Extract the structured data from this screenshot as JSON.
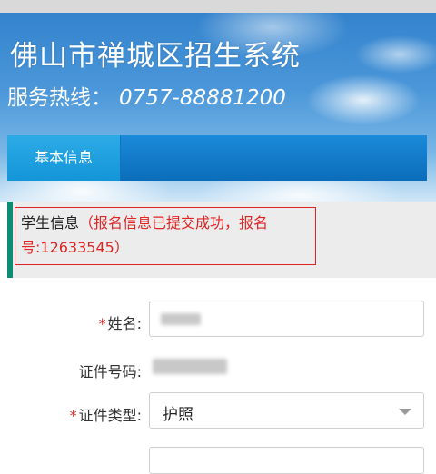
{
  "header": {
    "title": "佛山市禅城区招生系统",
    "hotline_label": "服务热线：",
    "hotline_number": "0757-88881200"
  },
  "nav": {
    "tabs": [
      {
        "label": "基本信息",
        "active": true
      }
    ]
  },
  "notice": {
    "label": "学生信息",
    "message": "（报名信息已提交成功，报名号:12633545）",
    "accent_color": "#0f8a73",
    "message_color": "#e02424"
  },
  "form": {
    "name": {
      "label": "姓名:",
      "required": true,
      "value_redacted": true
    },
    "id_number": {
      "label": "证件号码:",
      "required": false,
      "value_redacted": true
    },
    "id_type": {
      "label": "证件类型:",
      "required": true,
      "selected": "护照"
    }
  },
  "colors": {
    "nav_bar": "#0b6dba",
    "active_tab": "#1495d8",
    "required_mark": "#e02424"
  }
}
